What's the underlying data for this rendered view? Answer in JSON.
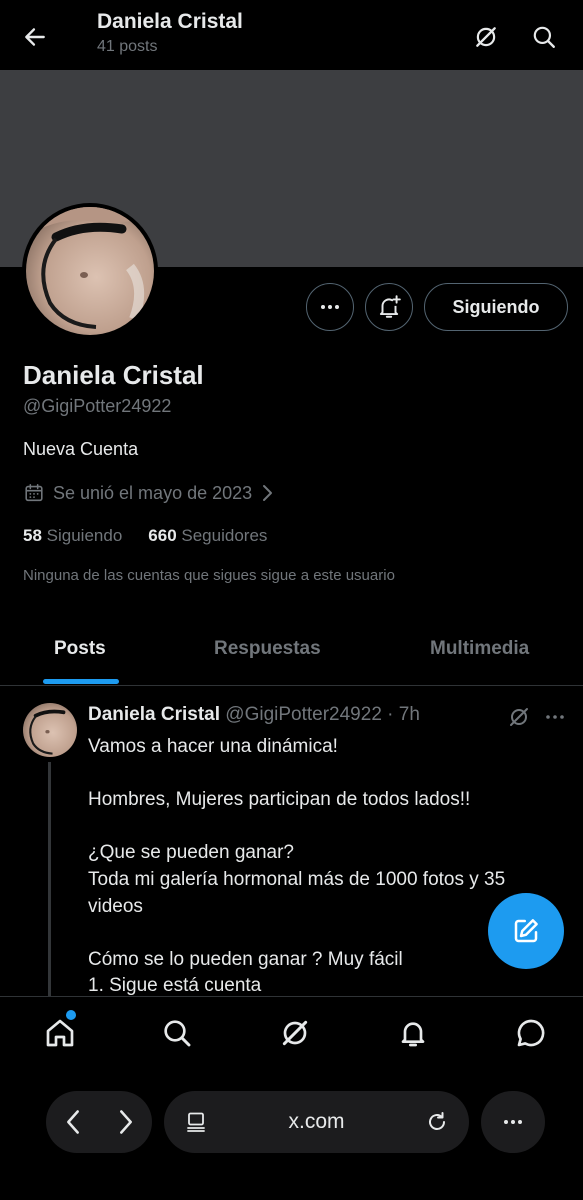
{
  "header": {
    "title": "Daniela Cristal",
    "subtitle": "41 posts"
  },
  "profile": {
    "name": "Daniela Cristal",
    "handle": "@GigiPotter24922",
    "bio": "Nueva Cuenta",
    "joined": "Se unió el mayo de 2023",
    "following_count": "58",
    "following_label": "Siguiendo",
    "followers_count": "660",
    "followers_label": "Seguidores",
    "mutual": "Ninguna de las cuentas que sigues sigue a este usuario",
    "follow_button": "Siguiendo"
  },
  "tabs": [
    {
      "label": "Posts",
      "active": true
    },
    {
      "label": "Respuestas",
      "active": false
    },
    {
      "label": "Multimedia",
      "active": false
    }
  ],
  "post": {
    "name": "Daniela Cristal",
    "meta": "@GigiPotter24922 · 7h",
    "lines": [
      "Vamos a hacer una dinámica!",
      "",
      "Hombres, Mujeres participan de todos lados!!",
      "",
      "¿Que se pueden ganar?",
      "Toda mi galería hormonal más de 1000 fotos y 35 videos",
      "",
      "Cómo se lo pueden ganar ? Muy fácil",
      "1. Sigue está cuenta"
    ]
  },
  "browser": {
    "url": "x.com"
  },
  "colors": {
    "accent": "#1d9bf0",
    "muted": "#71767b",
    "text": "#e7e9ea",
    "border": "#536471"
  }
}
